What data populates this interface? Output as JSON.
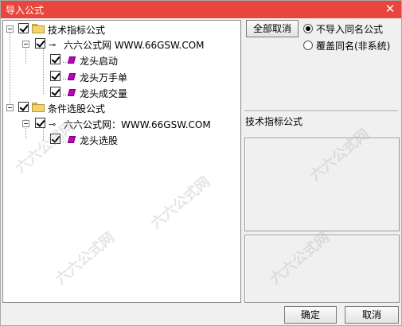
{
  "window": {
    "title": "导入公式"
  },
  "tree": {
    "groups": [
      {
        "label": "技术指标公式",
        "source": "六六公式网 WWW.66GSW.COM",
        "items": [
          "龙头启动",
          "龙头万手单",
          "龙头成交量"
        ]
      },
      {
        "label": "条件选股公式",
        "source": "六六公式网：WWW.66GSW.COM",
        "items": [
          "龙头选股"
        ]
      }
    ]
  },
  "options": {
    "deselect_all": "全部取消",
    "radio_skip": "不导入同名公式",
    "radio_overwrite": "覆盖同名(非系统)",
    "selected": "skip"
  },
  "details": {
    "section_label": "技术指标公式"
  },
  "footer": {
    "ok": "确定",
    "cancel": "取消"
  },
  "watermark": {
    "text": "六六公式网"
  }
}
